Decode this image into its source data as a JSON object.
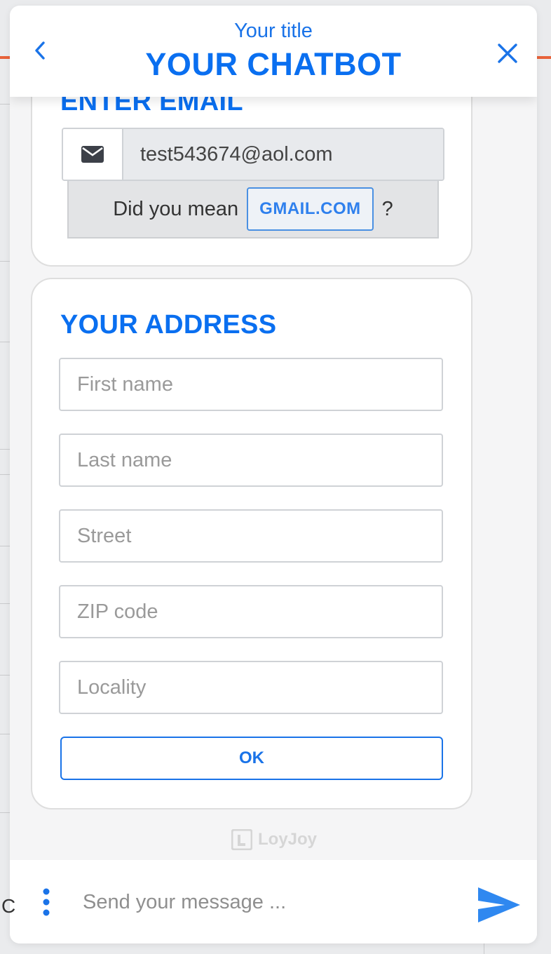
{
  "header": {
    "subtitle": "Your title",
    "title": "YOUR CHATBOT",
    "back_icon": "chevron-left-icon",
    "close_icon": "close-icon"
  },
  "email_card": {
    "title": "ENTER EMAIL",
    "email_value": "test543674@aol.com",
    "icon": "envelope-icon",
    "suggest_prefix": "Did you mean",
    "suggest_button": "GMAIL.COM",
    "suggest_suffix": "?"
  },
  "address_card": {
    "title": "YOUR ADDRESS",
    "fields": {
      "first_name": "First name",
      "last_name": "Last name",
      "street": "Street",
      "zip": "ZIP code",
      "locality": "Locality"
    },
    "ok_label": "OK"
  },
  "brand": {
    "name": "LoyJoy"
  },
  "footer": {
    "placeholder": "Send your message ...",
    "menu_icon": "more-vertical-icon",
    "send_icon": "send-icon"
  },
  "colors": {
    "accent": "#0a6ff0",
    "accent_light": "#1a73e8",
    "orange": "#e8623a"
  }
}
